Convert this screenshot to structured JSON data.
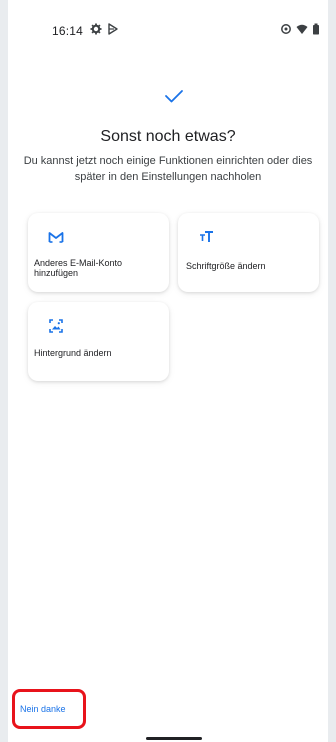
{
  "status_bar": {
    "time": "16:14",
    "icons_left": [
      "settings-icon",
      "play-store-icon"
    ],
    "icons_right": [
      "data-saver-icon",
      "wifi-icon",
      "battery-icon"
    ]
  },
  "header": {
    "title": "Sonst noch etwas?",
    "subtitle": "Du kannst jetzt noch einige Funktionen einrichten oder dies später in den Einstellungen nachholen"
  },
  "options": [
    {
      "icon": "gmail-icon",
      "label": "Anderes E-Mail-Konto hinzufügen"
    },
    {
      "icon": "font-size-icon",
      "label": "Schriftgröße ändern"
    },
    {
      "icon": "wallpaper-icon",
      "label": "Hintergrund ändern"
    }
  ],
  "footer": {
    "skip_label": "Nein danke"
  },
  "colors": {
    "accent": "#1a73e8",
    "highlight_border": "#e8131b",
    "text_primary": "#202124"
  }
}
